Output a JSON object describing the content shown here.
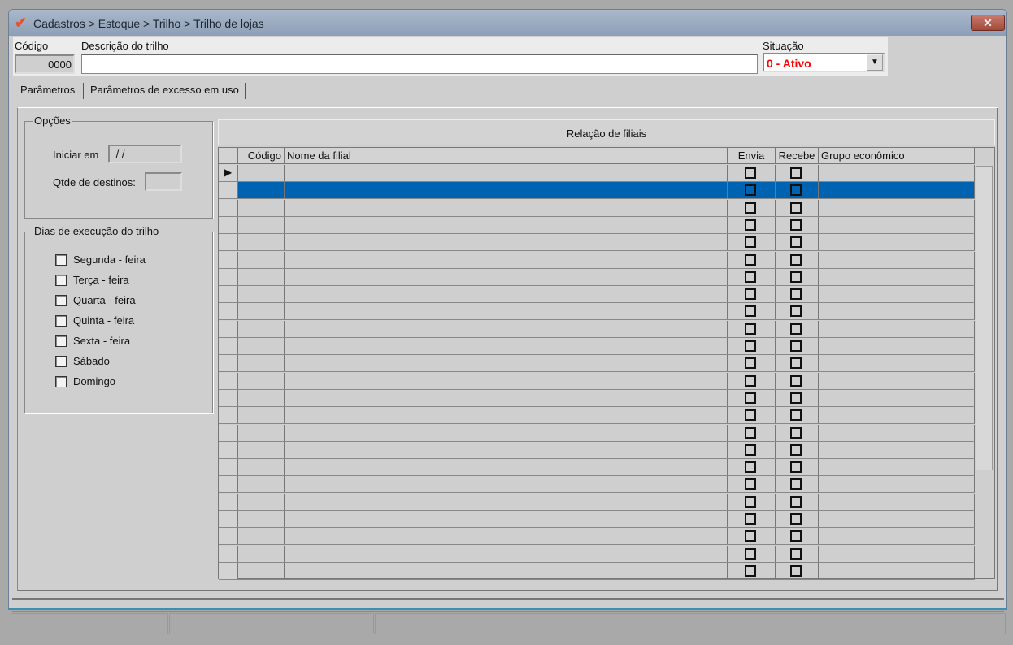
{
  "window": {
    "title": "Cadastros > Estoque > Trilho > Trilho de lojas",
    "close_icon": "close-icon"
  },
  "header": {
    "codigo_label": "Código",
    "codigo_value": "0000",
    "descricao_label": "Descrição do trilho",
    "descricao_value": "",
    "situacao_label": "Situação",
    "situacao_value": "0 - Ativo",
    "situacao_color": "#ff0000"
  },
  "tabs": [
    {
      "label": "Parâmetros",
      "active": true
    },
    {
      "label": "Parâmetros de excesso em uso",
      "active": false
    }
  ],
  "opcoes": {
    "title": "Opções",
    "iniciar_label": "Iniciar em",
    "iniciar_value": " / /",
    "qtde_label": "Qtde de destinos:",
    "qtde_value": ""
  },
  "dias": {
    "title": "Dias de execução do trilho",
    "items": [
      {
        "label": "Segunda - feira",
        "checked": false
      },
      {
        "label": "Terça - feira",
        "checked": false
      },
      {
        "label": "Quarta - feira",
        "checked": false
      },
      {
        "label": "Quinta - feira",
        "checked": false
      },
      {
        "label": "Sexta - feira",
        "checked": false
      },
      {
        "label": "Sábado",
        "checked": false
      },
      {
        "label": "Domingo",
        "checked": false
      }
    ]
  },
  "grid": {
    "title": "Relação de filiais",
    "columns": [
      "Código",
      "Nome da filial",
      "Envia",
      "Recebe",
      "Grupo econômico"
    ],
    "current_row": 0,
    "selected_row": 1,
    "selection_color": "#0063b1",
    "row_count": 24
  },
  "statusbar": {
    "panels": [
      "",
      "",
      ""
    ]
  }
}
